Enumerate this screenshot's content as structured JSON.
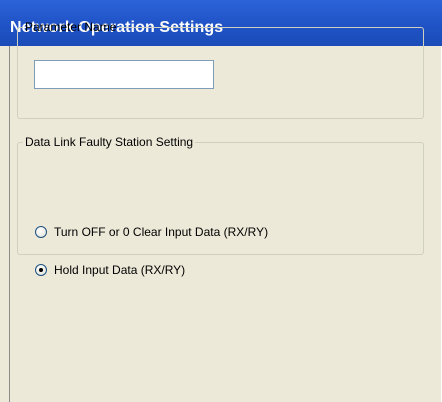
{
  "window": {
    "title": "Network Operation Settings"
  },
  "parameter_group": {
    "legend": "Parameter Name",
    "input_value": "",
    "input_placeholder": ""
  },
  "faulty_station_group": {
    "legend": "Data Link Faulty Station Setting",
    "options": [
      {
        "label": "Turn OFF or 0 Clear Input Data (RX/RY)",
        "selected": false
      },
      {
        "label": "Hold Input Data (RX/RY)",
        "selected": true
      }
    ]
  }
}
